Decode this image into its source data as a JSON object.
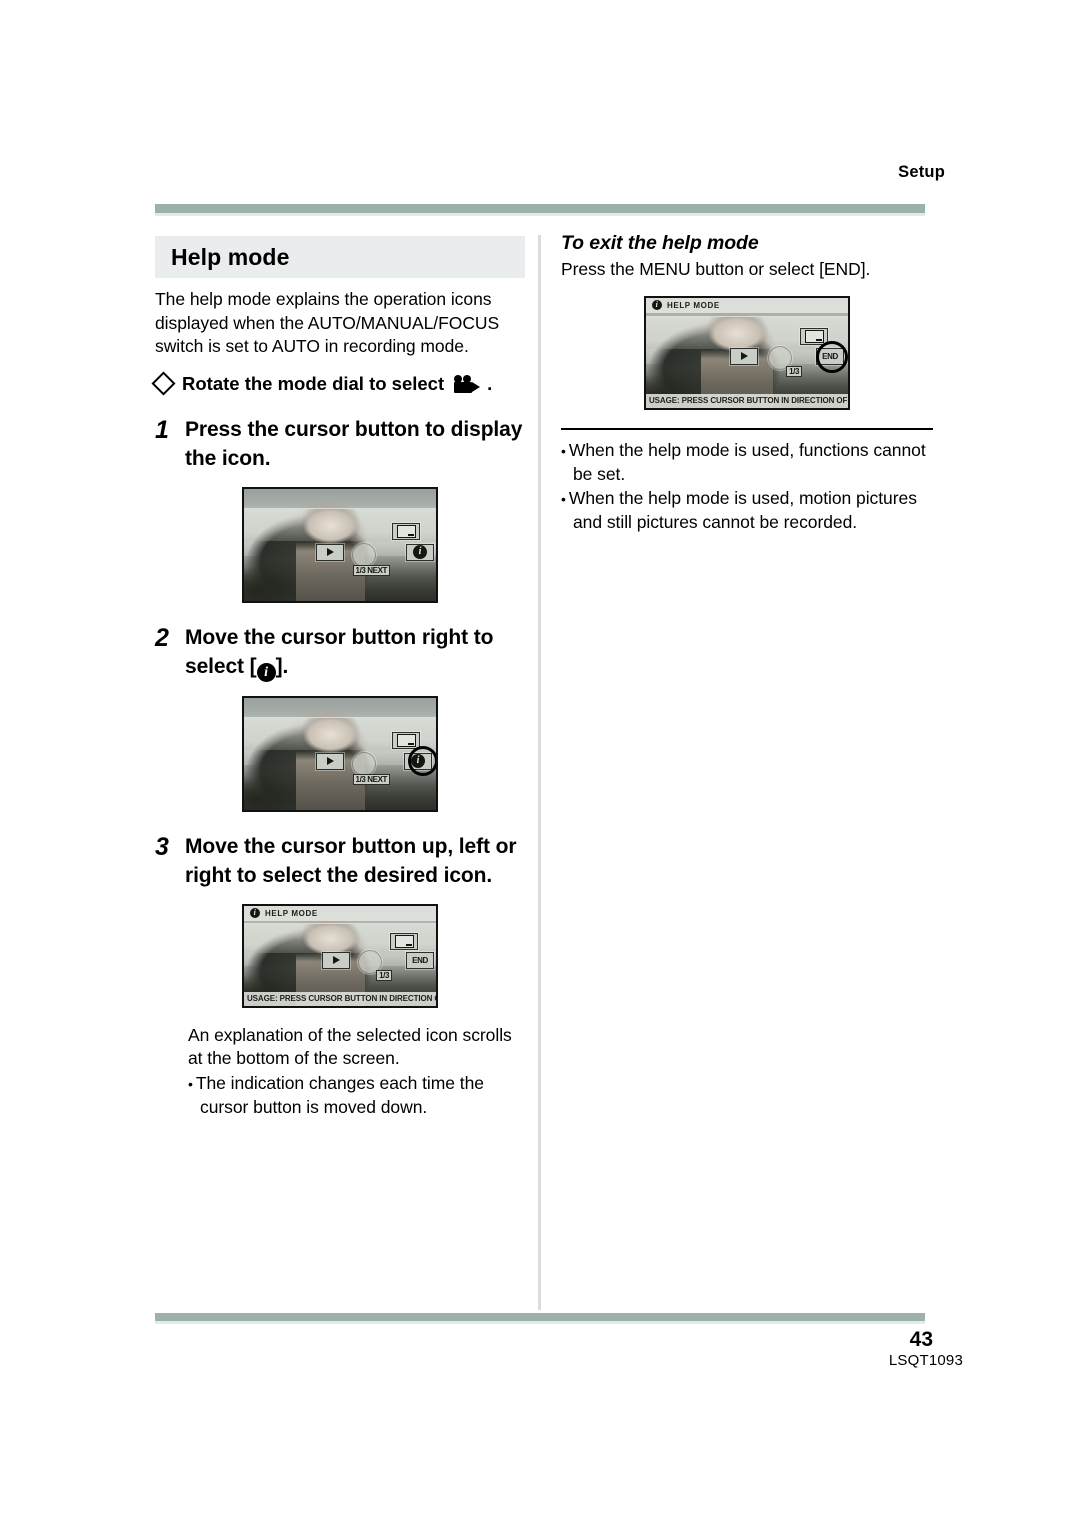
{
  "header": {
    "running_head": "Setup"
  },
  "footer": {
    "page_number": "43",
    "document_code": "LSQT1093"
  },
  "left_column": {
    "section_title": "Help mode",
    "intro_paragraph": "The help mode explains the operation icons displayed when the AUTO/MANUAL/FOCUS switch is set to AUTO in recording mode.",
    "prerequisite": {
      "diamond_icon": "diamond-icon",
      "text": "Rotate the mode dial to select",
      "mode_icon": "movie-camera-icon",
      "period": "."
    },
    "steps": [
      {
        "number": "1",
        "text": "Press the cursor button to display the icon."
      },
      {
        "number": "2",
        "text_before": "Move the cursor button right to select [",
        "icon": "info-icon",
        "text_after": "]."
      },
      {
        "number": "3",
        "text": "Move the cursor button up, left or right to select the desired icon."
      }
    ],
    "figure1": {
      "name": "lcd-screenshot-cursor-icons",
      "osd_up_icon": "thumbnail-icon",
      "osd_left_icon": "right-arrow-icon",
      "osd_right_icon": "info-icon",
      "page_counter": "1/3 NEXT"
    },
    "figure2": {
      "name": "lcd-screenshot-info-selected",
      "osd_up_icon": "thumbnail-icon",
      "osd_left_icon": "right-arrow-icon",
      "osd_right_icon": "info-icon",
      "page_counter": "1/3 NEXT",
      "selection": "info-icon"
    },
    "figure3": {
      "name": "lcd-screenshot-help-mode-active",
      "title_bar": "HELP MODE",
      "osd_up_icon": "thumbnail-icon",
      "osd_left_icon": "right-arrow-icon",
      "osd_right_label": "END",
      "page_counter": "1/3",
      "usage_bar": "USAGE: PRESS CURSOR BUTTON IN DIRECTION OF"
    },
    "after_step3_paragraph": "An explanation of the selected icon scrolls at the bottom of the screen.",
    "after_step3_bullets": [
      "The indication changes each time the cursor button is moved down."
    ]
  },
  "right_column": {
    "subhead": "To exit the help mode",
    "paragraph": "Press the MENU button or select [END].",
    "figure": {
      "name": "lcd-screenshot-end-selected",
      "title_bar": "HELP MODE",
      "osd_up_icon": "thumbnail-icon",
      "osd_left_icon": "right-arrow-icon",
      "osd_right_label": "END",
      "page_counter": "1/3",
      "usage_bar": "USAGE: PRESS CURSOR BUTTON IN DIRECTION OF",
      "selection": "END"
    },
    "bullets": [
      "When the help mode is used, functions cannot be set.",
      "When the help mode is used, motion pictures and still pictures cannot be recorded."
    ]
  },
  "colors": {
    "rule_bar": "#9cb0ac",
    "section_band": "#e9edee",
    "column_divider": "#dcdcdc"
  }
}
